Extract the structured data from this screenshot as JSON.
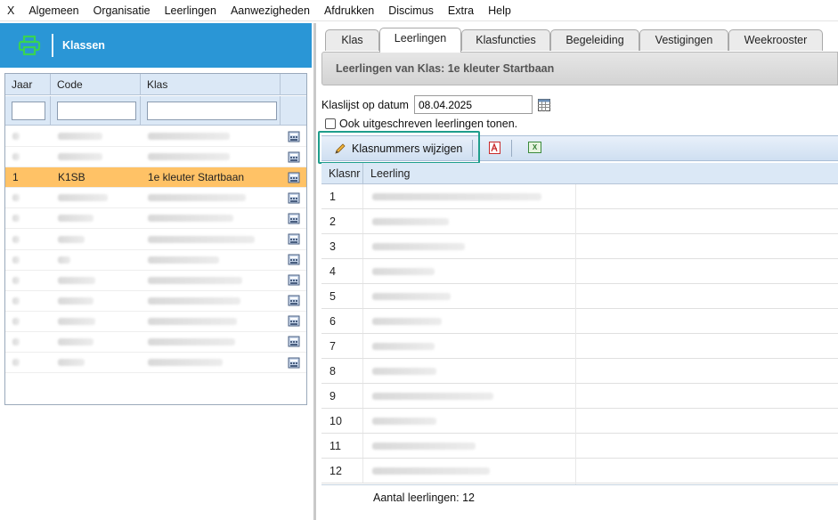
{
  "menu": [
    "X",
    "Algemeen",
    "Organisatie",
    "Leerlingen",
    "Aanwezigheden",
    "Afdrukken",
    "Discimus",
    "Extra",
    "Help"
  ],
  "left_panel": {
    "title": "Klassen",
    "columns": [
      "Jaar",
      "Code",
      "Klas"
    ],
    "selected_row": {
      "jaar": "1",
      "code": "K1SB",
      "klas": "1e kleuter Startbaan"
    }
  },
  "tabs": [
    "Klas",
    "Leerlingen",
    "Klasfuncties",
    "Begeleiding",
    "Vestigingen",
    "Weekrooster"
  ],
  "active_tab": "Leerlingen",
  "subheader": "Leerlingen van Klas: 1e kleuter Startbaan",
  "date": {
    "label": "Klaslijst op datum",
    "value": "08.04.2025"
  },
  "checkbox": {
    "label": "Ook uitgeschreven leerlingen tonen.",
    "checked": false
  },
  "toolbar": {
    "klasnr_button": "Klasnummers wijzigen",
    "excel_glyph": "X"
  },
  "students_table": {
    "columns": [
      "Klasnr",
      "Leerling"
    ],
    "klasnrs": [
      "1",
      "2",
      "3",
      "4",
      "5",
      "6",
      "7",
      "8",
      "9",
      "10",
      "11",
      "12"
    ]
  },
  "footer": "Aantal leerlingen: 12",
  "colors": {
    "header_blue": "#2a96d6",
    "selected_row": "#ffc266",
    "highlight": "#1f9e8c",
    "printer_green": "#39d353"
  }
}
